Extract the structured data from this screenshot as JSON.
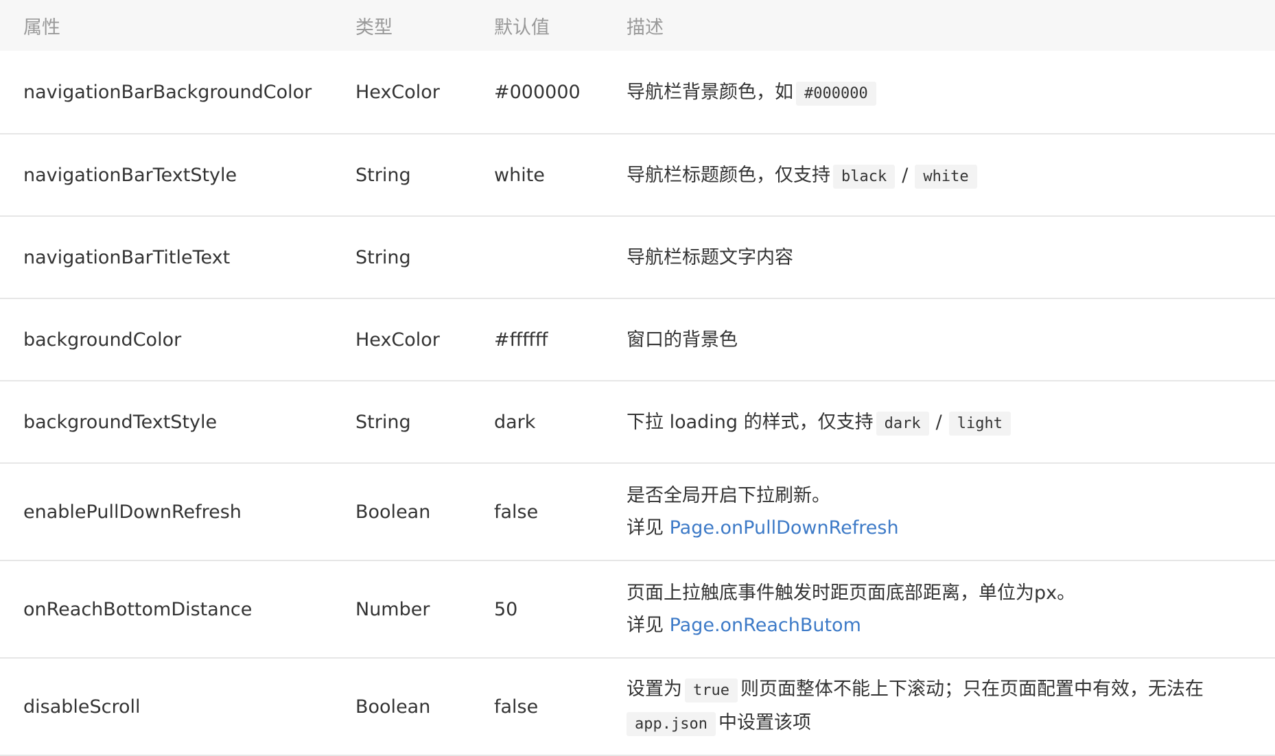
{
  "header": {
    "col_attr": "属性",
    "col_type": "类型",
    "col_default": "默认值",
    "col_desc": "描述"
  },
  "rows": [
    {
      "attr": "navigationBarBackgroundColor",
      "type": "HexColor",
      "default": "#000000",
      "desc_text": "导航栏背景颜色，如",
      "desc_code": "#000000"
    },
    {
      "attr": "navigationBarTextStyle",
      "type": "String",
      "default": "white",
      "desc_text": "导航栏标题颜色，仅支持",
      "desc_code1": "black",
      "desc_sep": "/",
      "desc_code2": "white"
    },
    {
      "attr": "navigationBarTitleText",
      "type": "String",
      "default": "",
      "desc_text": "导航栏标题文字内容"
    },
    {
      "attr": "backgroundColor",
      "type": "HexColor",
      "default": "#ffffff",
      "desc_text": "窗口的背景色"
    },
    {
      "attr": "backgroundTextStyle",
      "type": "String",
      "default": "dark",
      "desc_text": "下拉 loading 的样式，仅支持",
      "desc_code1": "dark",
      "desc_sep": "/",
      "desc_code2": "light"
    },
    {
      "attr": "enablePullDownRefresh",
      "type": "Boolean",
      "default": "false",
      "desc_line1": "是否全局开启下拉刷新。",
      "desc_see": "详见",
      "desc_link": "Page.onPullDownRefresh"
    },
    {
      "attr": "onReachBottomDistance",
      "type": "Number",
      "default": "50",
      "desc_line1": "页面上拉触底事件触发时距页面底部距离，单位为px。",
      "desc_see": "详见",
      "desc_link": "Page.onReachButom"
    },
    {
      "attr": "disableScroll",
      "type": "Boolean",
      "default": "false",
      "desc_pre": "设置为",
      "desc_code1": "true",
      "desc_post": "则页面整体不能上下滚动；只在页面配置中有效，无法在",
      "desc_code2": "app.json",
      "desc_tail": "中设置该项"
    }
  ],
  "colors": {
    "header_bg": "#f7f7f7",
    "header_text": "#999999",
    "text": "#333333",
    "link": "#3d7ac7",
    "border": "#e6e6e6",
    "code_bg": "#f3f3f3"
  }
}
